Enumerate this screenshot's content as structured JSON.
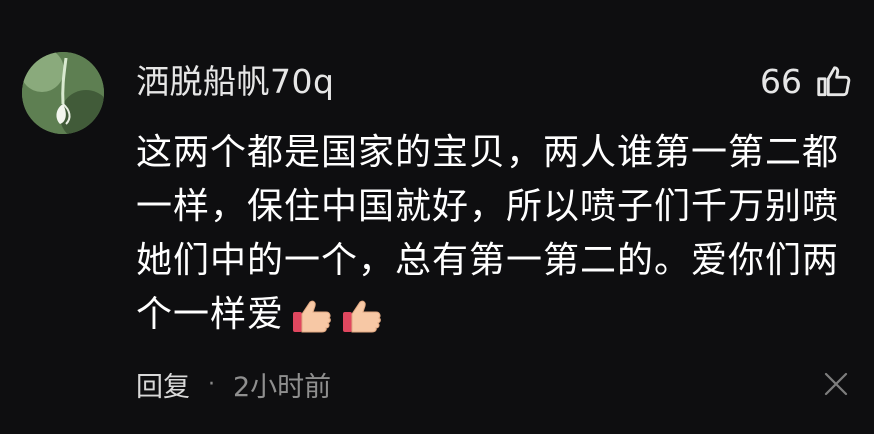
{
  "comment": {
    "username": "洒脱船帆70q",
    "like_count": "66",
    "text": "这两个都是国家的宝贝，两人谁第一第二都一样，保住中国就好，所以喷子们千万别喷她们中的一个，总有第一第二的。爱你们两个一样爱",
    "emojis": [
      "thumbs-up-emoji",
      "thumbs-up-emoji"
    ],
    "reply_label": "回复",
    "separator": "·",
    "time": "2小时前"
  },
  "icons": {
    "avatar": "snowdrop-flower-avatar",
    "like": "thumbs-up-outline-icon",
    "close": "close-icon"
  },
  "colors": {
    "background": "#0e0e10",
    "text": "#ffffff",
    "secondary_text": "#8f8f8f"
  }
}
